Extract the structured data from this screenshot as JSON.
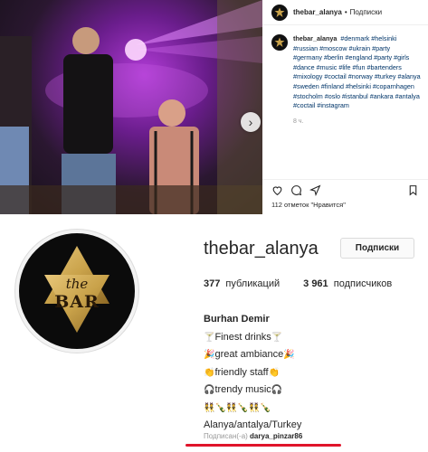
{
  "post": {
    "header_username": "thebar_alanya",
    "header_separator": "•",
    "header_follow": "Подписки",
    "caption_username": "thebar_alanya",
    "caption_tags": "#denmark #helsinki #russian #moscow #ukrain #party #germany #berlin #england #party #girls #dance #music #life #fun #bartenders #mixology #coctail #norway #turkey #alanya #sweden #finland #helsinki #coparnhagen #stocholm #oslo #istanbul #ankara #antalya #coctail #instagram",
    "time": "8 ч.",
    "likes": "112 отметок \"Нравится\"",
    "next_arrow": "›"
  },
  "profile": {
    "username": "thebar_alanya",
    "follow_button": "Подписки",
    "avatar_text_top": "the",
    "avatar_text_bottom": "BAR",
    "posts_count": "377",
    "posts_label": "публикаций",
    "followers_count": "3 961",
    "followers_label": "подписчиков",
    "full_name": "Burhan Demir",
    "bio_lines": [
      {
        "prefix": "🍸",
        "text": "Finest drinks",
        "suffix": "🍸"
      },
      {
        "prefix": "🎉",
        "text": "great ambiance",
        "suffix": "🎉"
      },
      {
        "prefix": "👏",
        "text": "friendly staff",
        "suffix": "👏"
      },
      {
        "prefix": "🎧",
        "text": "trendy music",
        "suffix": "🎧"
      },
      {
        "prefix": "",
        "text": "👯🍾👯🍾👯🍾",
        "suffix": ""
      }
    ],
    "location": "Alanya/antalya/Turkey",
    "followed_by_label": "Подписан(-а)",
    "followed_by_user": "darya_pinzar86"
  },
  "colors": {
    "accent_red": "#e0142a",
    "hashtag_blue": "#003569",
    "star_gold": "#c9a24a"
  }
}
